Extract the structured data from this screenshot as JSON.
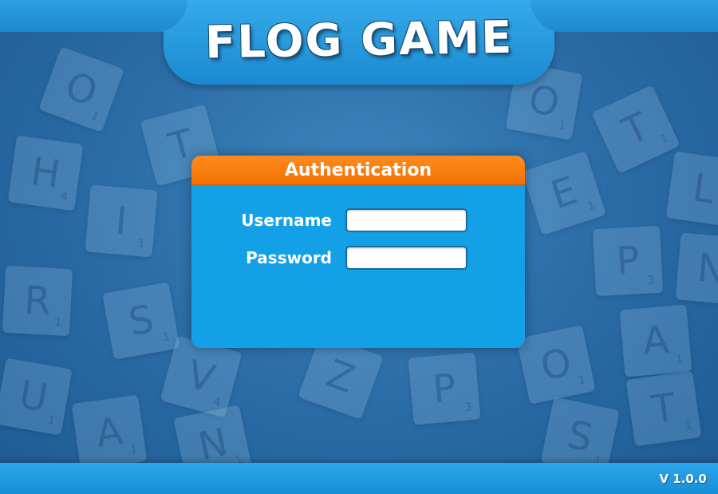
{
  "header": {
    "title": "FLOG GAME"
  },
  "auth_panel": {
    "title": "Authentication",
    "username_label": "Username",
    "username_value": "",
    "password_label": "Password",
    "password_value": ""
  },
  "footer": {
    "version": "V 1.0.0"
  },
  "background_tiles": [
    {
      "letter": "O",
      "points": "1"
    },
    {
      "letter": "T",
      "points": ""
    },
    {
      "letter": "H",
      "points": "4"
    },
    {
      "letter": "I",
      "points": "1"
    },
    {
      "letter": "R",
      "points": "1"
    },
    {
      "letter": "S",
      "points": "1"
    },
    {
      "letter": "V",
      "points": "4"
    },
    {
      "letter": "U",
      "points": "1"
    },
    {
      "letter": "A",
      "points": "1"
    },
    {
      "letter": "N",
      "points": "1"
    },
    {
      "letter": "Z",
      "points": ""
    },
    {
      "letter": "P",
      "points": "3"
    },
    {
      "letter": "O",
      "points": "1"
    },
    {
      "letter": "T",
      "points": "1"
    },
    {
      "letter": "E",
      "points": "1"
    },
    {
      "letter": "L",
      "points": ""
    },
    {
      "letter": "P",
      "points": "3"
    },
    {
      "letter": "N",
      "points": ""
    },
    {
      "letter": "A",
      "points": "1"
    },
    {
      "letter": "O",
      "points": "1"
    },
    {
      "letter": "T",
      "points": "1"
    },
    {
      "letter": "S",
      "points": "1"
    }
  ],
  "colors": {
    "background": "#2c6ea8",
    "banner": "#1e9be0",
    "panel": "#14a0e6",
    "panel_header": "#f27200",
    "text": "#ffffff"
  }
}
